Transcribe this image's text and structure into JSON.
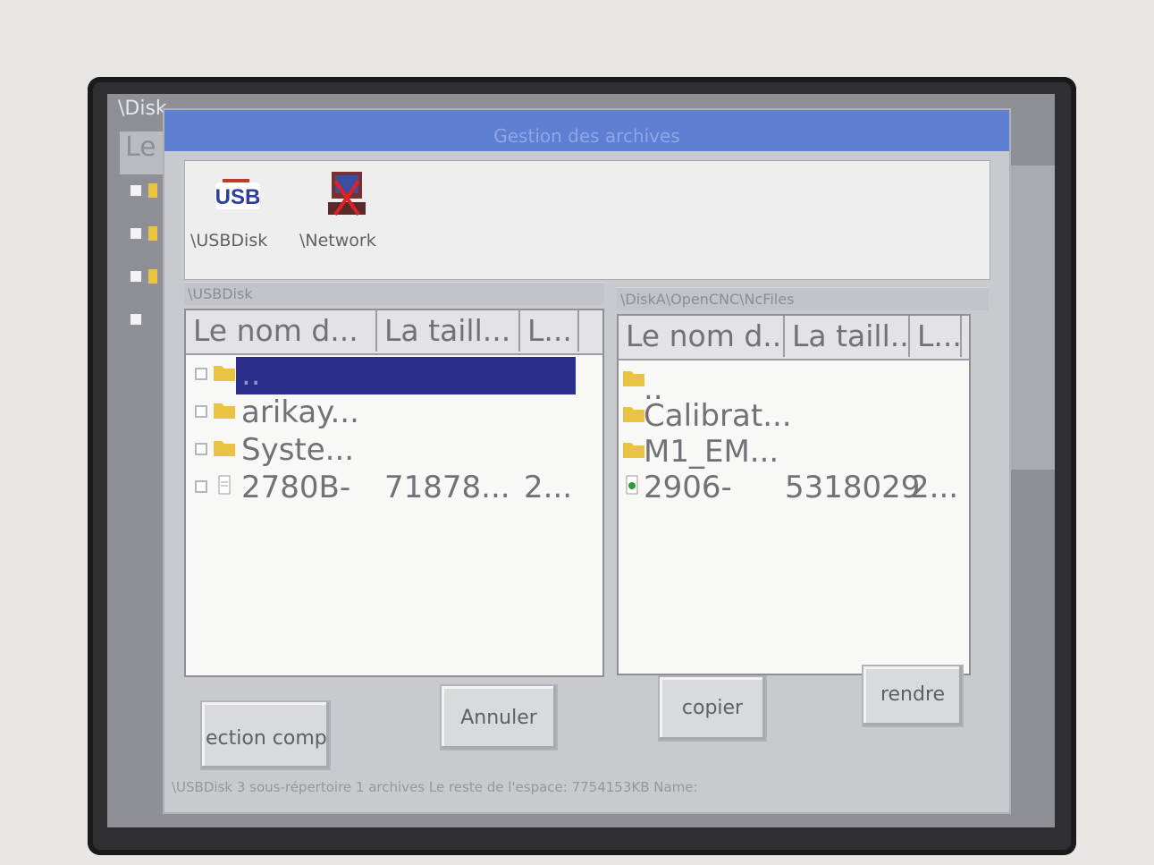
{
  "background": {
    "path_text": "\\Disk",
    "tab_text": "Le"
  },
  "dialog": {
    "title": "Gestion des archives",
    "drives": [
      {
        "label": "\\USBDisk",
        "icon": "usb-icon"
      },
      {
        "label": "\\Network",
        "icon": "network-drive-icon"
      }
    ]
  },
  "left_panel": {
    "path": "\\USBDisk",
    "columns": [
      "Le nom d...",
      "La taill...",
      "L..."
    ],
    "rows": [
      {
        "name": "..",
        "size": "",
        "date": "",
        "type": "folder",
        "selected": true
      },
      {
        "name": "arikay...",
        "size": "",
        "date": "",
        "type": "folder"
      },
      {
        "name": "Syste...",
        "size": "",
        "date": "",
        "type": "folder"
      },
      {
        "name": "2780B-",
        "size": "71878...",
        "date": "2...",
        "type": "file"
      }
    ]
  },
  "right_panel": {
    "path": "\\DiskA\\OpenCNC\\NcFiles",
    "columns": [
      "Le nom d...",
      "La taill...",
      "L..."
    ],
    "rows": [
      {
        "name": "..",
        "size": "",
        "date": "",
        "type": "folder"
      },
      {
        "name": "Calibrat...",
        "size": "",
        "date": "",
        "type": "folder"
      },
      {
        "name": "M1_EM...",
        "size": "",
        "date": "",
        "type": "folder"
      },
      {
        "name": "2906-",
        "size": "5318029",
        "date": "2...",
        "type": "file"
      }
    ]
  },
  "buttons": {
    "select_all": "ection comp",
    "cancel": "Annuler",
    "copy": "copier",
    "rename": "rendre"
  },
  "status_bar": "\\USBDisk 3 sous-répertoire 1 archives Le reste de l'espace: 7754153KB  Name:",
  "colors": {
    "selection": "#2b2e8a",
    "title_bar": "#5f7fd2",
    "folder": "#e9c341"
  }
}
